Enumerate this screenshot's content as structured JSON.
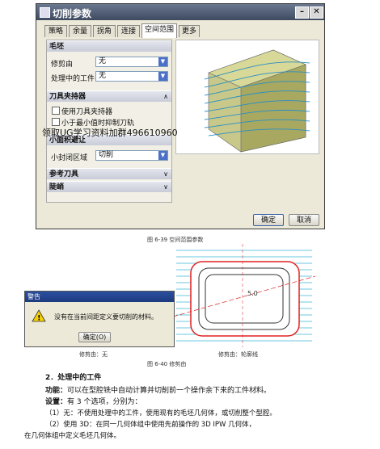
{
  "dialog": {
    "title": "切削参数",
    "tabs": [
      "策略",
      "余量",
      "拐角",
      "连接",
      "空间范围",
      "更多"
    ],
    "active_tab": "空间范围",
    "sections": {
      "blank": {
        "title": "毛坯"
      },
      "tool_holder": {
        "title": "刀具夹持器"
      },
      "small_area": {
        "title": "小面积避让"
      },
      "ref_tool": {
        "title": "参考刀具"
      },
      "steep": {
        "title": "陡峭"
      }
    },
    "fields": {
      "trim_by": {
        "label": "修剪由",
        "value": "无"
      },
      "ipw": {
        "label": "处理中的工件",
        "value": "无"
      },
      "small_closed": {
        "label": "小封闭区域",
        "value": "切削"
      }
    },
    "checkboxes": {
      "use_holder": "使用刀具夹持器",
      "min_value": "小于最小值时抑制刀轨"
    },
    "buttons": {
      "ok": "确定",
      "cancel": "取消"
    }
  },
  "watermark": "领取UG学习资料加群496610960",
  "fig_6_39_caption": "图 6-39  空间范围参数",
  "warning": {
    "title": "警告",
    "message": "没有在当前间距定义要切削的材料。",
    "ok": "确定(O)"
  },
  "fig_6_40": {
    "left_label": "修剪由：无",
    "right_label": "修剪由：轮廓线",
    "caption": "图 6-40  修剪由",
    "annotation": "5.0"
  },
  "text": {
    "heading": "2．处理中的工件",
    "line1_bold": "功能：",
    "line1": "可以在型腔铣中自动计算并切削前一个操作余下来的工件材料。",
    "line2_bold": "设置：",
    "line2": "有 3 个选项，分别为：",
    "line3": "（1）无：不使用处理中的工件，使用现有的毛坯几何体，或切削整个型腔。",
    "line4": "（2）使用 3D：在同一几何体组中使用先前操作的 3D IPW 几何体，",
    "line5": "在几何体组中定义毛坯几何体。"
  }
}
